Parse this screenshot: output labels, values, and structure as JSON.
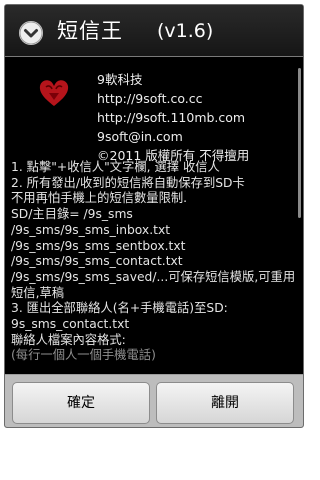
{
  "dialog": {
    "title": "短信王",
    "version": "(v1.6)",
    "title_icon": "chevron-down-circle-icon"
  },
  "info": {
    "logo_icon": "red-heart-logo",
    "company": "9軟科技",
    "site1": "http://9soft.co.cc",
    "site2": "http://9soft.110mb.com",
    "email": "9soft@in.com",
    "copyright": "©2011 版權所有 不得擅用"
  },
  "body": {
    "lines": [
      "1. 點擊\"+收信人\"文字欄, 選擇 收信人",
      "2. 所有發出/收到的短信將自動保存到SD卡",
      "不用再怕手機上的短信數量限制.",
      " SD/主目錄= /9s_sms",
      " /9s_sms/9s_sms_inbox.txt",
      " /9s_sms/9s_sms_sentbox.txt",
      " /9s_sms/9s_sms_contact.txt",
      " /9s_sms/9s_sms_saved/...可保存短信模版,可重用短信,草稿",
      "3. 匯出全部聯絡人(名+手機電話)至SD:",
      "   9s_sms_contact.txt",
      " 聯絡人檔案內容格式:",
      " (每行一個人一個手機電話)"
    ]
  },
  "buttons": {
    "ok": "確定",
    "close": "離開"
  }
}
